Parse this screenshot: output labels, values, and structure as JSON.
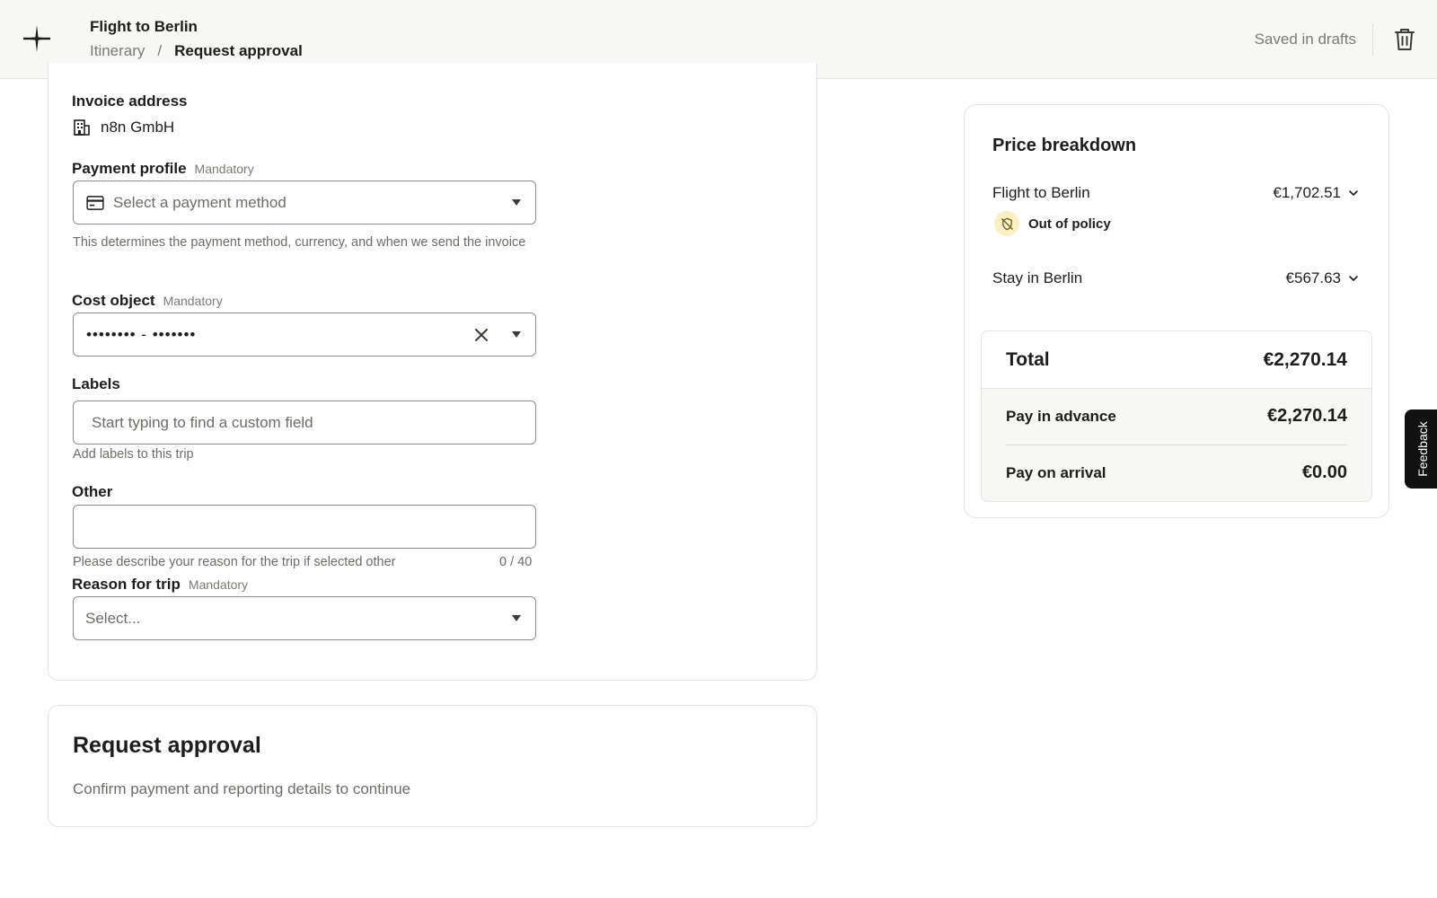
{
  "header": {
    "trip_title": "Flight to Berlin",
    "breadcrumb": {
      "link": "Itinerary",
      "separator": "/",
      "current": "Request approval"
    },
    "save_status": "Saved in drafts"
  },
  "form": {
    "invoice": {
      "label": "Invoice address",
      "company": "n8n GmbH"
    },
    "payment_profile": {
      "label": "Payment profile",
      "mandatory": "Mandatory",
      "placeholder": "Select a payment method",
      "helper": "This determines the payment method, currency, and when we send the invoice"
    },
    "cost_object": {
      "label": "Cost object",
      "mandatory": "Mandatory",
      "value": "•••••••• - •••••••"
    },
    "labels": {
      "label": "Labels",
      "placeholder": "Start typing to find a custom field",
      "helper": "Add labels to this trip"
    },
    "other": {
      "label": "Other",
      "value": "",
      "helper": "Please describe your reason for the trip if selected other",
      "counter": "0 / 40"
    },
    "reason": {
      "label": "Reason for trip",
      "mandatory": "Mandatory",
      "placeholder": "Select..."
    }
  },
  "approval": {
    "title": "Request approval",
    "subtitle": "Confirm payment and reporting details to continue"
  },
  "price": {
    "title": "Price breakdown",
    "items": [
      {
        "label": "Flight to Berlin",
        "value": "€1,702.51",
        "badge": "Out of policy"
      },
      {
        "label": "Stay in Berlin",
        "value": "€567.63"
      }
    ],
    "total": {
      "label": "Total",
      "value": "€2,270.14"
    },
    "advance": {
      "label": "Pay in advance",
      "value": "€2,270.14"
    },
    "arrival": {
      "label": "Pay on arrival",
      "value": "€0.00"
    }
  },
  "feedback": {
    "label": "Feedback"
  },
  "colors": {
    "policy_badge_bg": "#faf0c4",
    "feedback_bg": "#111111"
  }
}
